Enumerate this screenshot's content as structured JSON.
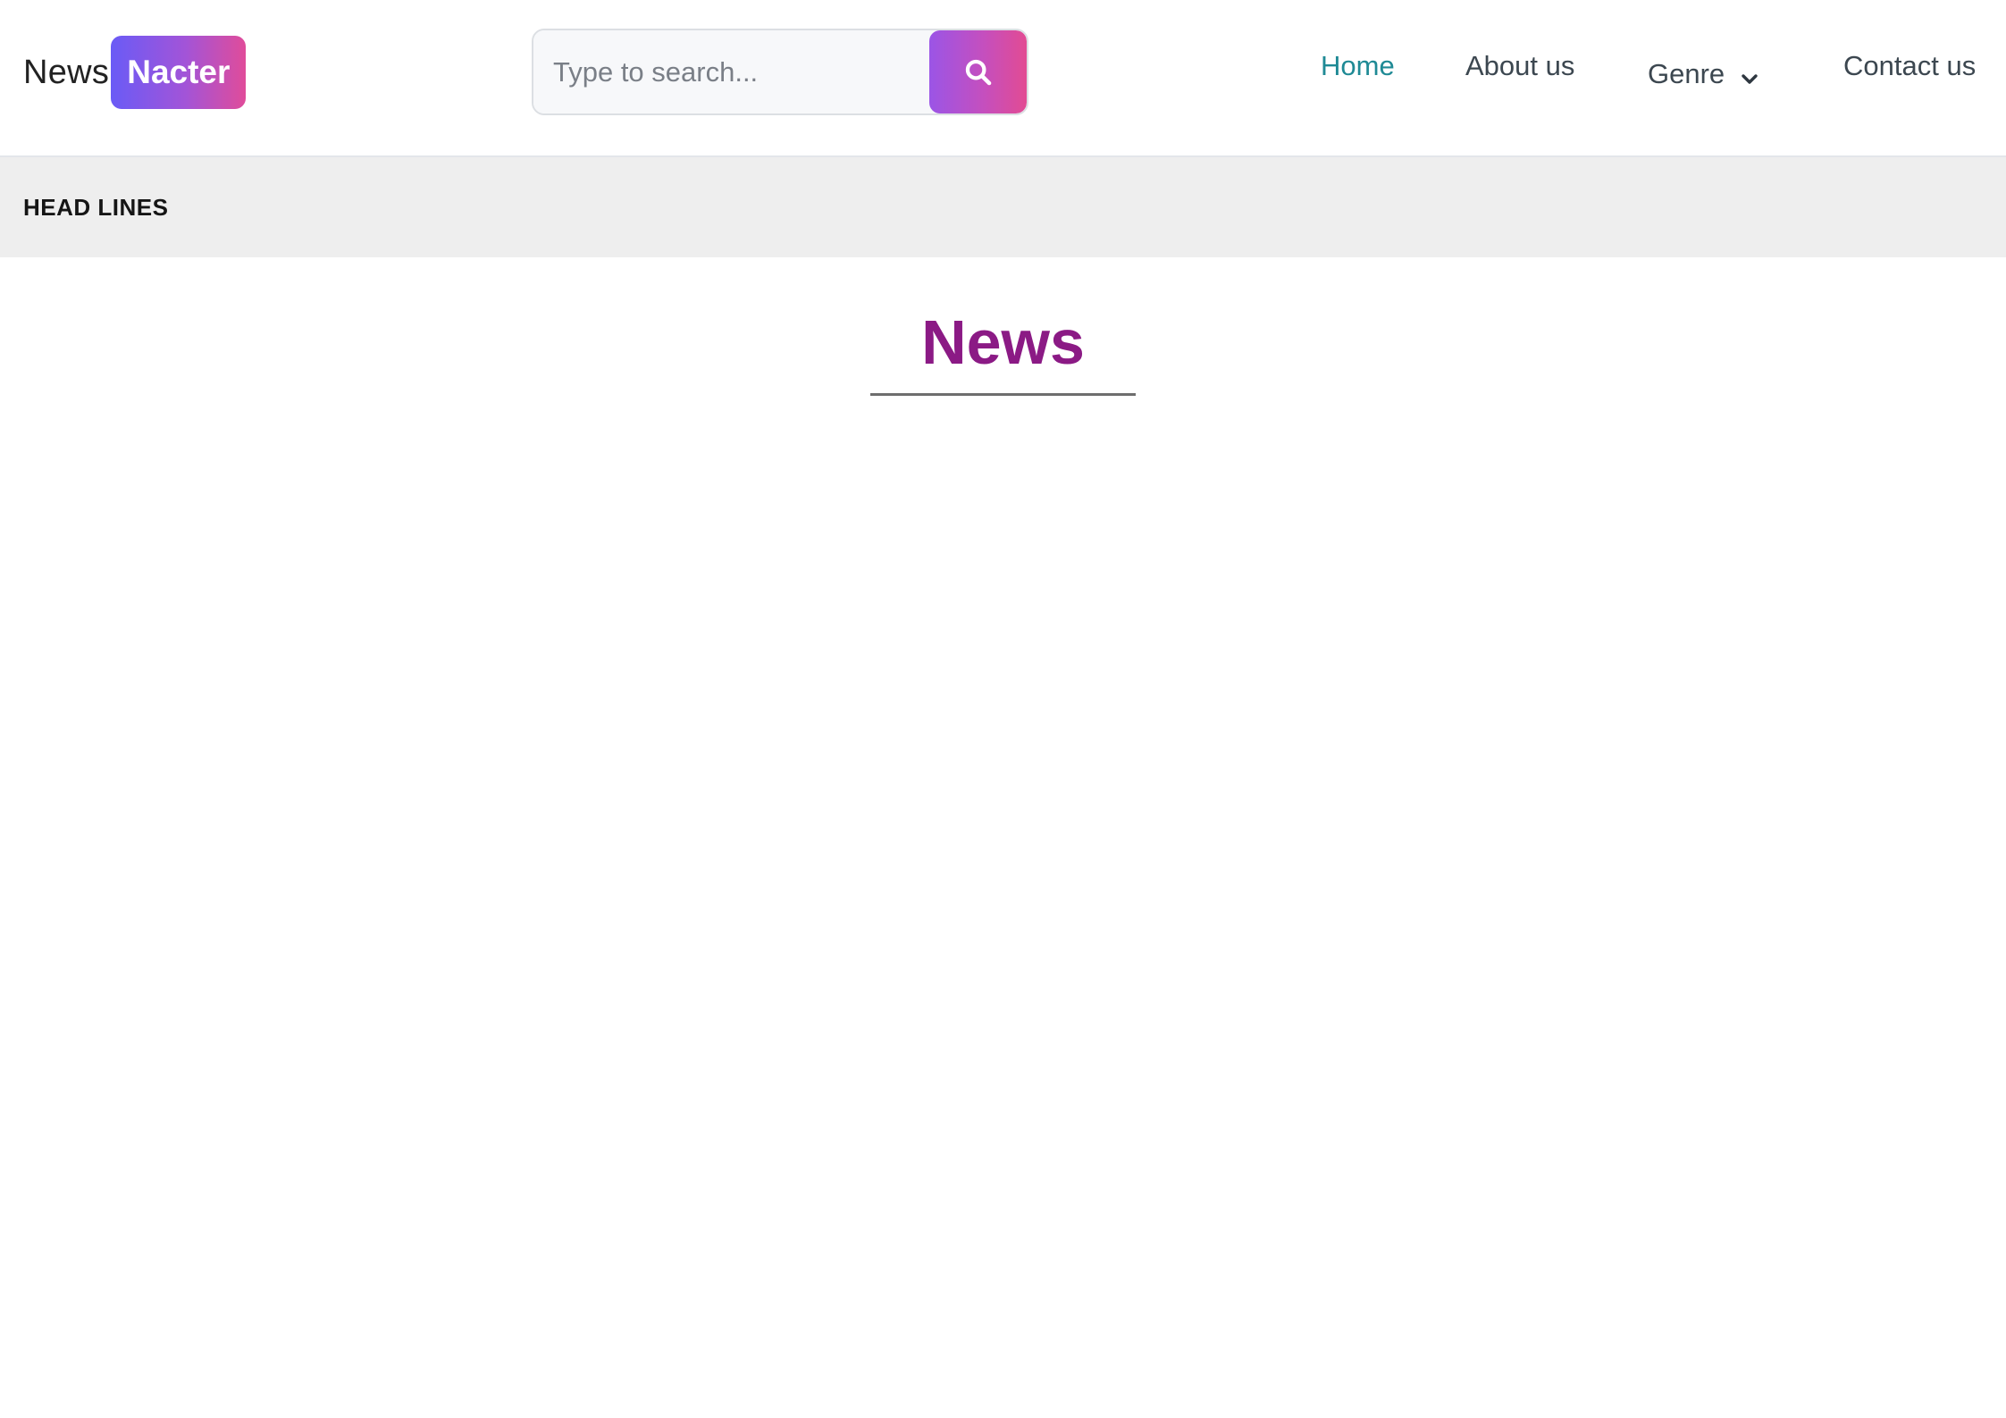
{
  "header": {
    "logo": {
      "word": "News",
      "badge": "Nacter"
    },
    "search": {
      "placeholder": "Type to search...",
      "value": "",
      "button_icon": "search-icon"
    },
    "nav": {
      "items": [
        {
          "label": "Home",
          "active": true
        },
        {
          "label": "About us",
          "active": false
        },
        {
          "label": "Genre",
          "active": false,
          "icon": "chevron-down-icon"
        },
        {
          "label": "Contact us",
          "active": false
        }
      ]
    }
  },
  "headlines": {
    "label": "HEAD LINES"
  },
  "main": {
    "section_title": "News"
  },
  "colors": {
    "accent_teal": "#1f8a95",
    "title_purple": "#8b1a85",
    "gradient_start": "#6a5bf6",
    "gradient_end": "#e04c9a",
    "headlines_bg": "#eeeeee"
  }
}
